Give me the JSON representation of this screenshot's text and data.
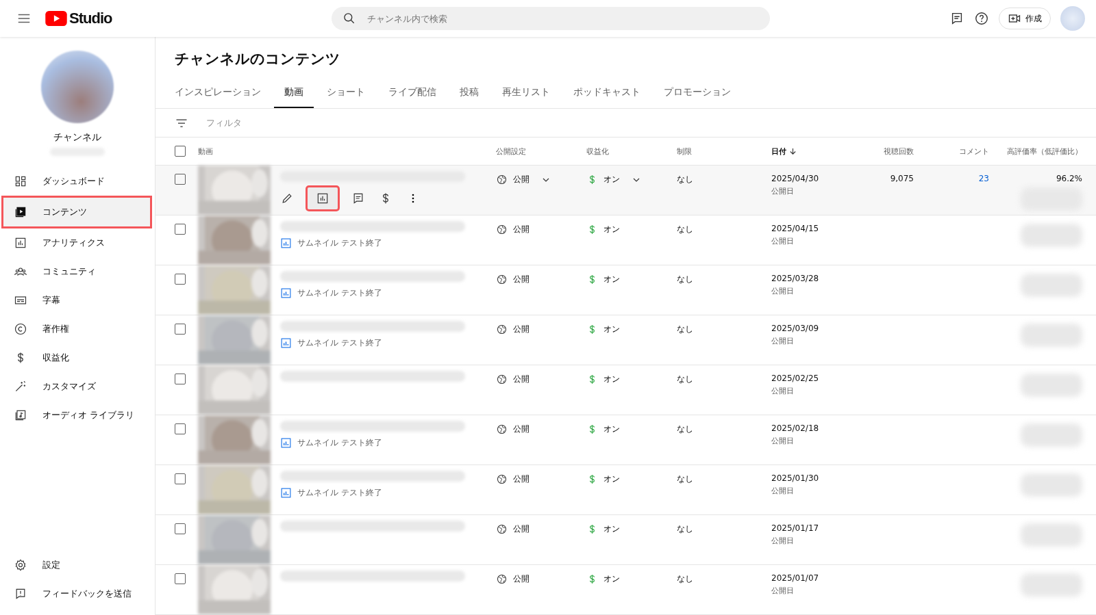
{
  "header": {
    "logo_text": "Studio",
    "search": {
      "placeholder": "チャンネル内で検索"
    },
    "create_label": "作成"
  },
  "sidebar": {
    "channel_name": "チャンネル",
    "items": [
      {
        "label": "ダッシュボード",
        "selected": false
      },
      {
        "label": "コンテンツ",
        "selected": true
      },
      {
        "label": "アナリティクス",
        "selected": false
      },
      {
        "label": "コミュニティ",
        "selected": false
      },
      {
        "label": "字幕",
        "selected": false
      },
      {
        "label": "著作権",
        "selected": false
      },
      {
        "label": "収益化",
        "selected": false
      },
      {
        "label": "カスタマイズ",
        "selected": false
      },
      {
        "label": "オーディオ ライブラリ",
        "selected": false
      }
    ],
    "bottom_items": [
      {
        "label": "設定"
      },
      {
        "label": "フィードバックを送信"
      }
    ]
  },
  "page_title": "チャンネルのコンテンツ",
  "tabs": [
    {
      "label": "インスピレーション",
      "selected": false
    },
    {
      "label": "動画",
      "selected": true
    },
    {
      "label": "ショート",
      "selected": false
    },
    {
      "label": "ライブ配信",
      "selected": false
    },
    {
      "label": "投稿",
      "selected": false
    },
    {
      "label": "再生リスト",
      "selected": false
    },
    {
      "label": "ポッドキャスト",
      "selected": false
    },
    {
      "label": "プロモーション",
      "selected": false
    }
  ],
  "filter_placeholder": "フィルタ",
  "table": {
    "select_all_checked": false,
    "columns": [
      "動画",
      "公開設定",
      "収益化",
      "制限",
      "日付",
      "視聴回数",
      "コメント",
      "高評価率（低評価比）"
    ],
    "rows": [
      {
        "hovered": true,
        "visibility": "公開",
        "monetization": "オン",
        "restriction": "なし",
        "date": "2025/04/30",
        "date_label": "公開日",
        "views": "9,075",
        "comments": "23",
        "rating": "96.2%"
      },
      {
        "hovered": false,
        "visibility": "公開",
        "monetization": "オン",
        "restriction": "なし",
        "date": "2025/04/15",
        "date_label": "公開日",
        "note": "サムネイル テスト終了"
      },
      {
        "hovered": false,
        "visibility": "公開",
        "monetization": "オン",
        "restriction": "なし",
        "date": "2025/03/28",
        "date_label": "公開日",
        "note": "サムネイル テスト終了"
      },
      {
        "hovered": false,
        "visibility": "公開",
        "monetization": "オン",
        "restriction": "なし",
        "date": "2025/03/09",
        "date_label": "公開日",
        "note": "サムネイル テスト終了"
      },
      {
        "hovered": false,
        "visibility": "公開",
        "monetization": "オン",
        "restriction": "なし",
        "date": "2025/02/25",
        "date_label": "公開日"
      },
      {
        "hovered": false,
        "visibility": "公開",
        "monetization": "オン",
        "restriction": "なし",
        "date": "2025/02/18",
        "date_label": "公開日",
        "note": "サムネイル テスト終了"
      },
      {
        "hovered": false,
        "visibility": "公開",
        "monetization": "オン",
        "restriction": "なし",
        "date": "2025/01/30",
        "date_label": "公開日",
        "note": "サムネイル テスト終了"
      },
      {
        "hovered": false,
        "visibility": "公開",
        "monetization": "オン",
        "restriction": "なし",
        "date": "2025/01/17",
        "date_label": "公開日"
      },
      {
        "hovered": false,
        "visibility": "公開",
        "monetization": "オン",
        "restriction": "なし",
        "date": "2025/01/07",
        "date_label": "公開日"
      }
    ]
  }
}
